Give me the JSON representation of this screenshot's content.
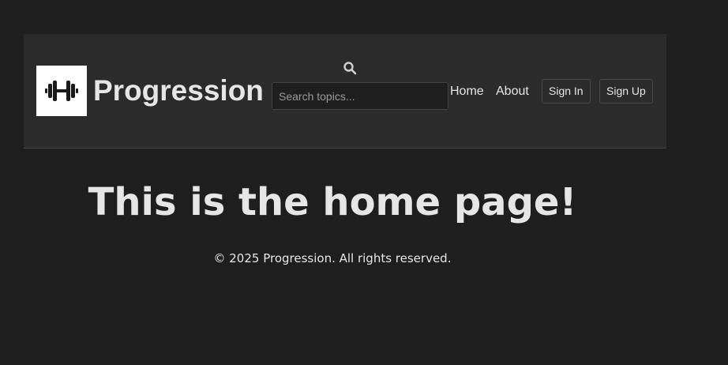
{
  "header": {
    "brand": "Progression",
    "logo_icon": "dumbbell-icon",
    "search": {
      "icon": "search-icon",
      "placeholder": "Search topics...",
      "value": ""
    },
    "nav": [
      {
        "label": "Home"
      },
      {
        "label": "About"
      }
    ],
    "sign_in_label": "Sign In",
    "sign_up_label": "Sign Up"
  },
  "main": {
    "heading": "This is the home page!"
  },
  "footer": {
    "text": "© 2025 Progression. All rights reserved."
  },
  "colors": {
    "page_bg": "#1e1e1e",
    "header_bg": "#2b2b2b",
    "text": "#e6e6e6",
    "logo_bg": "#ffffff"
  }
}
